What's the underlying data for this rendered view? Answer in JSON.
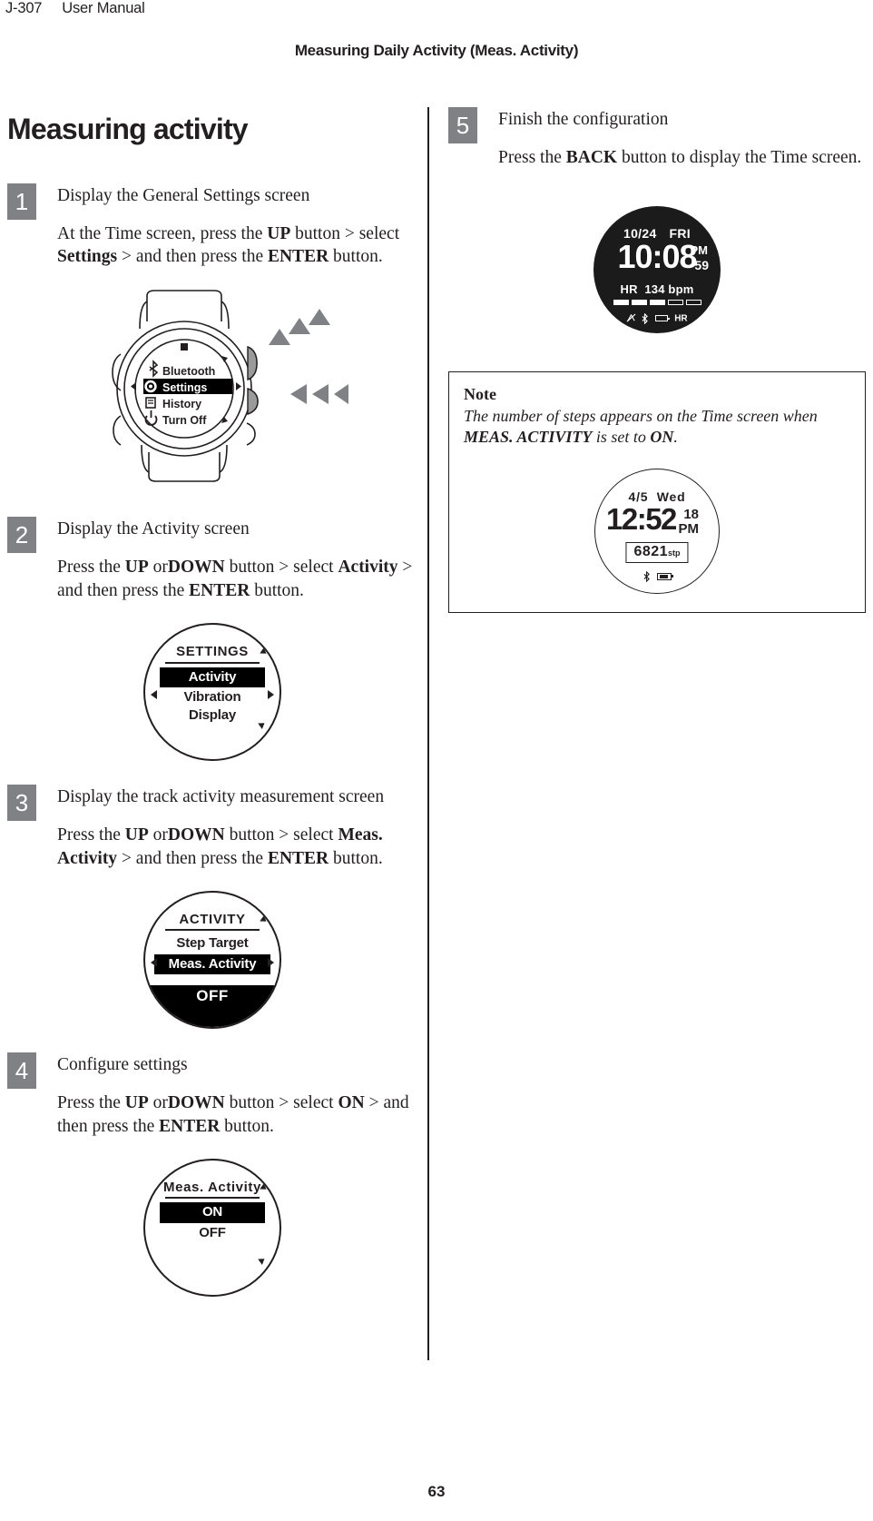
{
  "header": {
    "doc_code": "J-307",
    "doc_title": "User Manual",
    "chapter_title": "Measuring Daily Activity (Meas. Activity)"
  },
  "footer": {
    "page_number": "63"
  },
  "section": {
    "title": "Measuring activity"
  },
  "steps": [
    {
      "number": "1",
      "heading": "Display the General Settings screen",
      "body_parts": [
        {
          "t": "At the Time screen, press the ",
          "b": false
        },
        {
          "t": "UP",
          "b": true
        },
        {
          "t": " button > select ",
          "b": false
        },
        {
          "t": "Settings",
          "b": true
        },
        {
          "t": " > and then press the ",
          "b": false
        },
        {
          "t": "ENTER",
          "b": true
        },
        {
          "t": " button.",
          "b": false
        }
      ]
    },
    {
      "number": "2",
      "heading": "Display the Activity screen",
      "body_parts": [
        {
          "t": "Press the ",
          "b": false
        },
        {
          "t": "UP",
          "b": true
        },
        {
          "t": " or",
          "b": false
        },
        {
          "t": "DOWN",
          "b": true
        },
        {
          "t": " button > select ",
          "b": false
        },
        {
          "t": "Activity",
          "b": true
        },
        {
          "t": " > and then press the ",
          "b": false
        },
        {
          "t": "ENTER",
          "b": true
        },
        {
          "t": " button.",
          "b": false
        }
      ]
    },
    {
      "number": "3",
      "heading": "Display the track activity measurement screen",
      "body_parts": [
        {
          "t": "Press the ",
          "b": false
        },
        {
          "t": "UP",
          "b": true
        },
        {
          "t": " or",
          "b": false
        },
        {
          "t": "DOWN",
          "b": true
        },
        {
          "t": " button > select ",
          "b": false
        },
        {
          "t": "Meas. Activity",
          "b": true
        },
        {
          "t": " > and then press the ",
          "b": false
        },
        {
          "t": "ENTER",
          "b": true
        },
        {
          "t": " button.",
          "b": false
        }
      ]
    },
    {
      "number": "4",
      "heading": "Configure settings",
      "body_parts": [
        {
          "t": "Press the ",
          "b": false
        },
        {
          "t": "UP",
          "b": true
        },
        {
          "t": " or",
          "b": false
        },
        {
          "t": "DOWN",
          "b": true
        },
        {
          "t": " button > select ",
          "b": false
        },
        {
          "t": "ON",
          "b": true
        },
        {
          "t": " > and then press the ",
          "b": false
        },
        {
          "t": "ENTER",
          "b": true
        },
        {
          "t": " button.",
          "b": false
        }
      ]
    },
    {
      "number": "5",
      "heading": "Finish the configuration",
      "body_parts": [
        {
          "t": "Press the ",
          "b": false
        },
        {
          "t": "BACK",
          "b": true
        },
        {
          "t": " button to display the Time screen.",
          "b": false
        }
      ]
    }
  ],
  "figures": {
    "watch_menu": {
      "items": [
        {
          "icon": "bluetooth-icon",
          "label": "Bluetooth",
          "selected": false
        },
        {
          "icon": "gear-icon",
          "label": "Settings",
          "selected": true
        },
        {
          "icon": "history-icon",
          "label": "History",
          "selected": false
        },
        {
          "icon": "power-icon",
          "label": "Turn Off",
          "selected": false
        }
      ]
    },
    "settings_screen": {
      "title": "SETTINGS",
      "items": [
        {
          "label": "Activity",
          "selected": true
        },
        {
          "label": "Vibration",
          "selected": false
        },
        {
          "label": "Display",
          "selected": false
        }
      ]
    },
    "activity_screen": {
      "title": "ACTIVITY",
      "items": [
        {
          "label": "Step Target",
          "selected": false
        },
        {
          "label": "Meas. Activity",
          "selected": true
        }
      ],
      "footer_value": "OFF"
    },
    "meas_activity_screen": {
      "title": "Meas. Activity",
      "items": [
        {
          "label": "ON",
          "selected": true
        },
        {
          "label": "OFF",
          "selected": false
        }
      ]
    },
    "time_screen": {
      "date": "10/24",
      "weekday": "FRI",
      "time": "10:08",
      "ampm": "PM",
      "seconds": "59",
      "hr_label": "HR",
      "hr_value": "134 bpm",
      "segments_filled": 3,
      "segments_empty": 2,
      "status_icons": [
        "gps-off-icon",
        "bluetooth-icon",
        "battery-icon",
        "hr-icon"
      ],
      "hr_icon_label": "HR"
    },
    "note_time_screen": {
      "date": "4/5",
      "weekday": "Wed",
      "time": "12:52",
      "seconds": "18",
      "ampm": "PM",
      "steps_value": "6821",
      "steps_unit": "stp",
      "status_icons": [
        "bluetooth-icon",
        "battery-icon"
      ]
    }
  },
  "note": {
    "title": "Note",
    "text_parts": [
      {
        "t": "The number of steps appears on the Time screen when ",
        "b": false
      },
      {
        "t": "MEAS. ACTIVITY",
        "b": true
      },
      {
        "t": " is set to ",
        "b": false
      },
      {
        "t": "ON",
        "b": true
      },
      {
        "t": ".",
        "b": false
      }
    ]
  },
  "colors": {
    "text": "#231f20",
    "badge_gray": "#808184",
    "lcd_black": "#1b1b1b",
    "arrow_gray": "#808184"
  }
}
